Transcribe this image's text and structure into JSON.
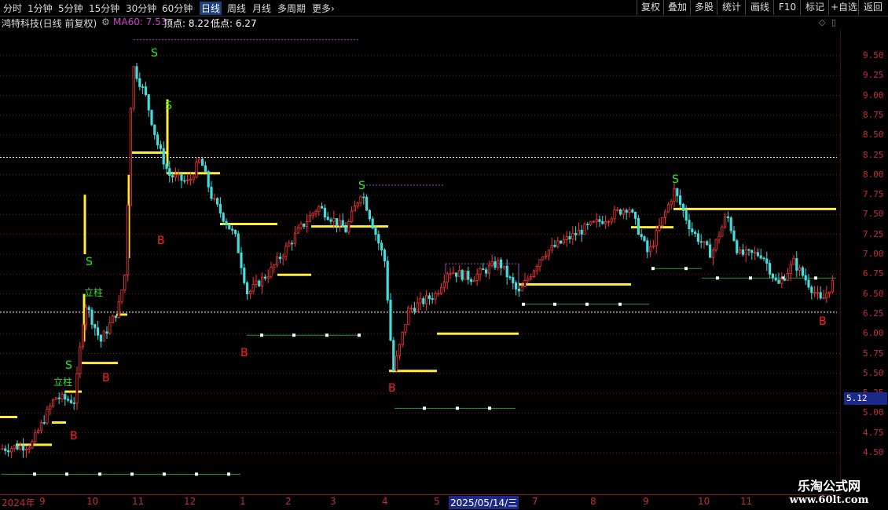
{
  "toolbar": {
    "periods": [
      "分时",
      "1分钟",
      "5分钟",
      "15分钟",
      "30分钟",
      "60分钟",
      "日线",
      "周线",
      "月线",
      "多周期",
      "更多"
    ],
    "more_arrow": "›",
    "active_period": "日线",
    "buttons": [
      "复权",
      "叠加",
      "多股",
      "统计",
      "画线",
      "F10",
      "标记",
      "+自选",
      "返回"
    ]
  },
  "info": {
    "stock_name": "鸿特科技(日线 前复权)",
    "ma_label": "MA60: 7.53",
    "top_label": "顶点: 8.22",
    "low_label": "低点: 6.27"
  },
  "price_axis": [
    "9.50",
    "9.25",
    "9.00",
    "8.75",
    "8.50",
    "8.25",
    "8.00",
    "7.75",
    "7.50",
    "7.25",
    "7.00",
    "6.75",
    "6.50",
    "6.25",
    "6.00",
    "5.75",
    "5.50",
    "5.25",
    "5.00",
    "4.75",
    "4.50"
  ],
  "current_price": "5.12",
  "time_axis": [
    "2024年",
    "9",
    "10",
    "11",
    "12",
    "1",
    "2",
    "3",
    "4",
    "5",
    "2025/05/14/三",
    "7",
    "8",
    "9",
    "10",
    "11"
  ],
  "signals": {
    "buy": "B",
    "sell": "S",
    "lizhu": "立柱"
  },
  "watermark": {
    "line1": "乐淘公式网",
    "line2": "www.60lt.com"
  },
  "colors": {
    "up": "#ff3333",
    "down": "#44dddd",
    "grid": "#7a1a1a",
    "level": "#ffee33",
    "buy": "#ff2020",
    "sell": "#22ee22"
  }
}
